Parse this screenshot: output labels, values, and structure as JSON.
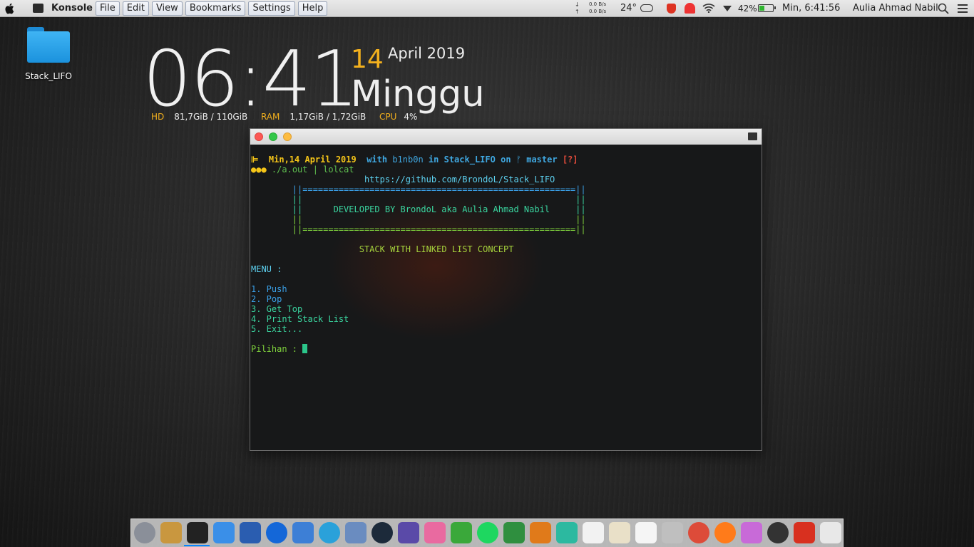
{
  "menubar": {
    "app_name": "Konsole",
    "menus": [
      "File",
      "Edit",
      "View",
      "Bookmarks",
      "Settings",
      "Help"
    ],
    "net_down": "0.0 B/s",
    "net_up": "0.0 B/s",
    "temperature": "24°",
    "battery_percent": "42%",
    "battery_level": 0.42,
    "datetime": "Min, 6:41:56",
    "user": "Aulia Ahmad Nabil"
  },
  "desktop": {
    "icon_label": "Stack_LIFO"
  },
  "widget": {
    "time": "06:41",
    "day": "14",
    "month_year": "April 2019",
    "day_name": "Minggu",
    "hd_label": "HD",
    "hd_value": "81,7GiB / 110GiB",
    "ram_label": "RAM",
    "ram_value": "1,17GiB / 1,72GiB",
    "cpu_label": "CPU",
    "cpu_value": "4%"
  },
  "terminal": {
    "prompt_icon": "⊫",
    "prompt_date": "Min,14 April 2019",
    "prompt_with": "with",
    "prompt_user": "b1nb0n",
    "prompt_in": "in",
    "prompt_dir": "Stack_LIFO",
    "prompt_on": "on",
    "prompt_branch_icon": "ᚠ",
    "prompt_branch": "master",
    "prompt_status": "[?]",
    "prompt_dots": "●●●",
    "command": "./a.out | lolcat",
    "url": "https://github.com/BrondoL/Stack_LIFO",
    "border_line": "||=====================================================||",
    "empty_line": "||                                                     ||",
    "dev_line": "||      DEVELOPED BY BrondoL aka Aulia Ahmad Nabil     ||",
    "concept": "STACK WITH LINKED LIST CONCEPT",
    "menu_title": "MENU :",
    "menu_items": [
      "1. Push",
      "2. Pop",
      "3. Get Top",
      "4. Print Stack List",
      "5. Exit..."
    ],
    "input_prompt": "Pilihan : "
  },
  "dock": {
    "icons": [
      "system-preferences-icon",
      "package-icon",
      "terminal-icon",
      "finder-icon",
      "word-icon",
      "teamviewer-icon",
      "app-grid-icon",
      "telegram-icon",
      "preview-icon",
      "steam-icon",
      "game-emulator-icon",
      "folder-pink-icon",
      "download-icon",
      "spotify-icon",
      "xcode-icon",
      "sublime-icon",
      "mosaic-icon",
      "notes-icon",
      "text-editor-icon",
      "arrow-app-icon",
      "mail-icon",
      "chrome-icon",
      "firefox-icon",
      "photos-icon",
      "dashboard-icon",
      "store-icon",
      "screen-recorder-icon"
    ]
  },
  "colors": {
    "accent_orange": "#f2b01e",
    "dock_indicator": "#0a84ff",
    "terminal_bg": "#171819"
  }
}
